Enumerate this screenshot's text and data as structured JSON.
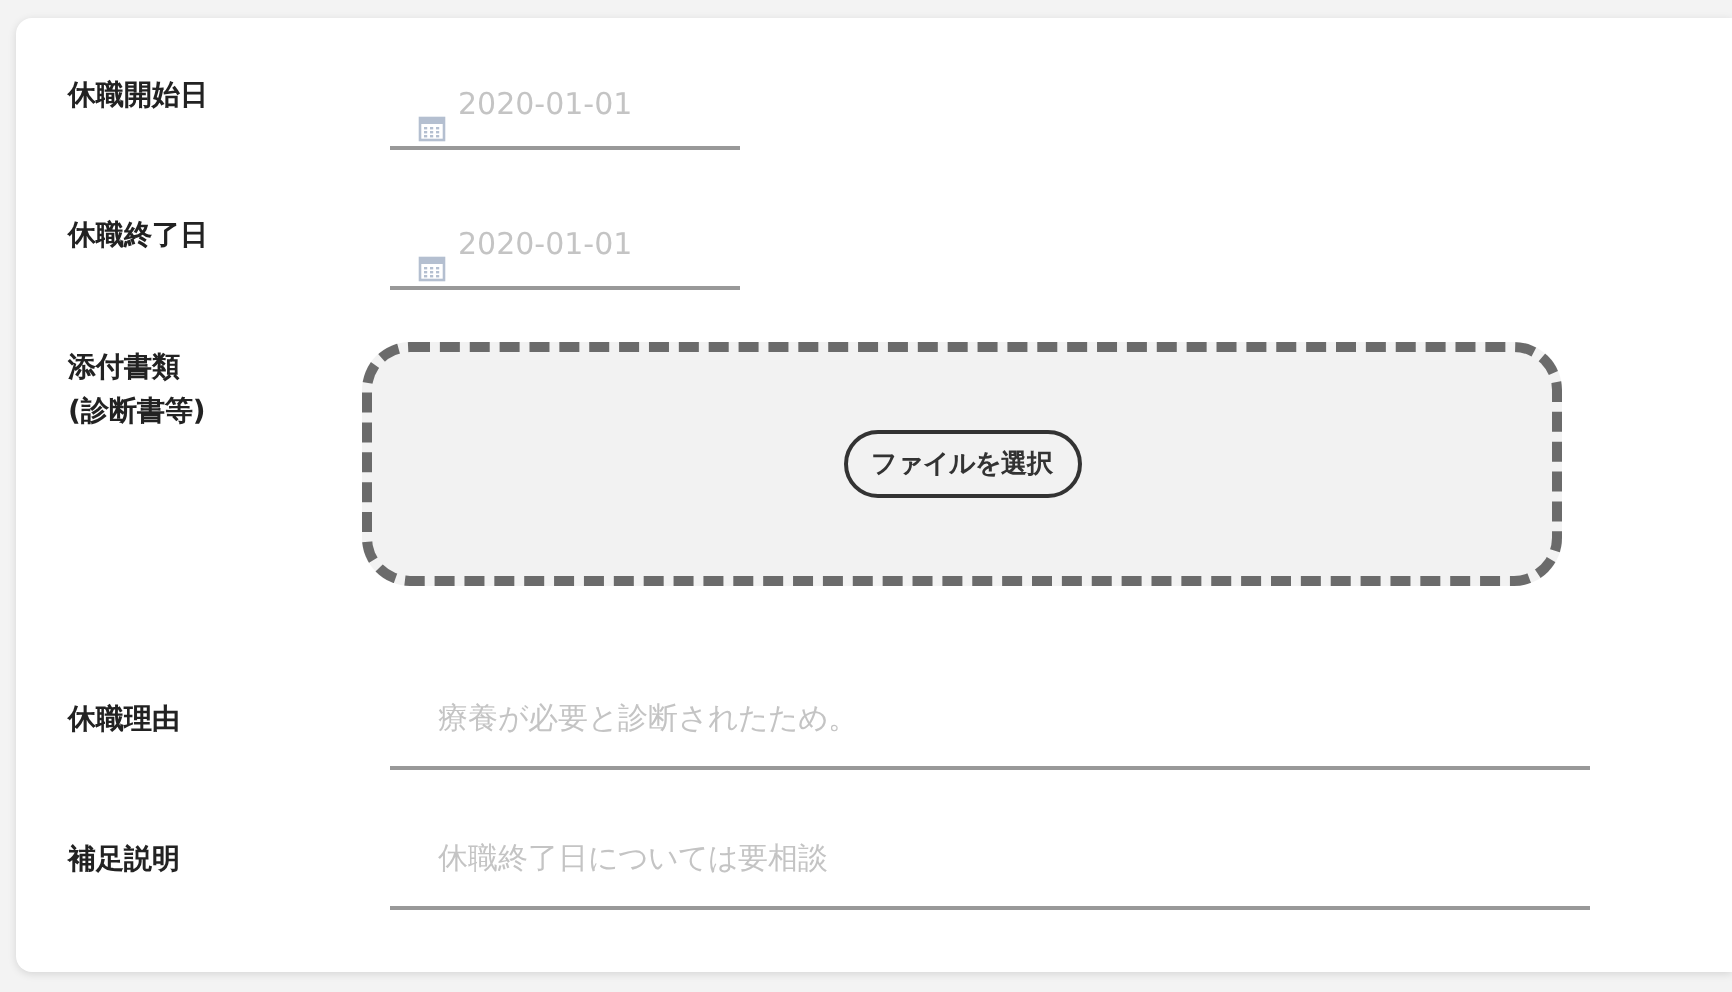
{
  "fields": [
    {
      "kind": "date",
      "label": "休職開始日",
      "placeholder": "2020-01-01"
    },
    {
      "kind": "date",
      "label": "休職終了日",
      "placeholder": "2020-01-01"
    },
    {
      "kind": "file",
      "label": "添付書類\n(診断書等)",
      "button": "ファイルを選択"
    },
    {
      "kind": "text",
      "label": "休職理由",
      "placeholder": "療養が必要と診断されたため。"
    },
    {
      "kind": "text",
      "label": "補足説明",
      "placeholder": "休職終了日については要相談"
    }
  ]
}
